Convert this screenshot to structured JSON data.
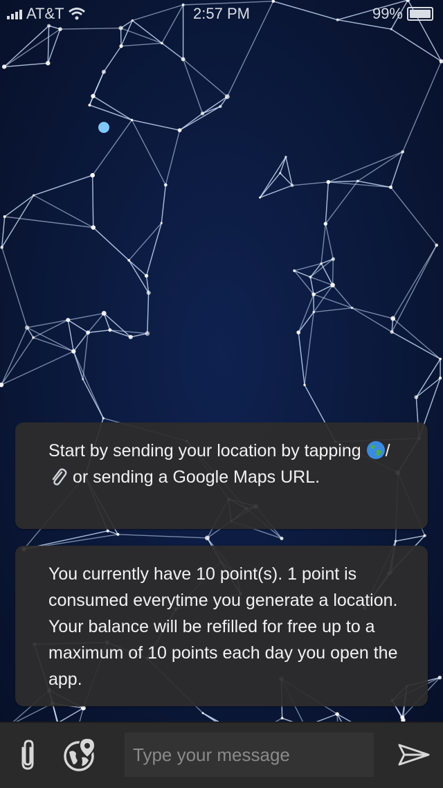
{
  "status_bar": {
    "carrier": "AT&T",
    "time": "2:57 PM",
    "battery": "99%",
    "battery_level": 0.99
  },
  "messages": [
    {
      "before_icons": "Start by sending your location by tapping ",
      "icon_1": "globe-emoji",
      "separator": "/",
      "icon_2": "paperclip-emoji",
      "after_icons": " or sending a Google Maps URL."
    },
    {
      "text": "You currently have 10 point(s). 1 point is consumed everytime you generate a location. Your balance will be refilled for free up to a maximum of 10 points each day you open the app."
    }
  ],
  "composer": {
    "attach_icon": "paperclip-icon",
    "location_icon": "globe-location-pin-icon",
    "placeholder": "Type your message",
    "value": "",
    "send_icon": "send-arrow-icon"
  },
  "colors": {
    "background": "#0b1633",
    "bubble": "#2e2c2c",
    "composer": "#2b2a2a",
    "text": "#f2f2f2"
  }
}
